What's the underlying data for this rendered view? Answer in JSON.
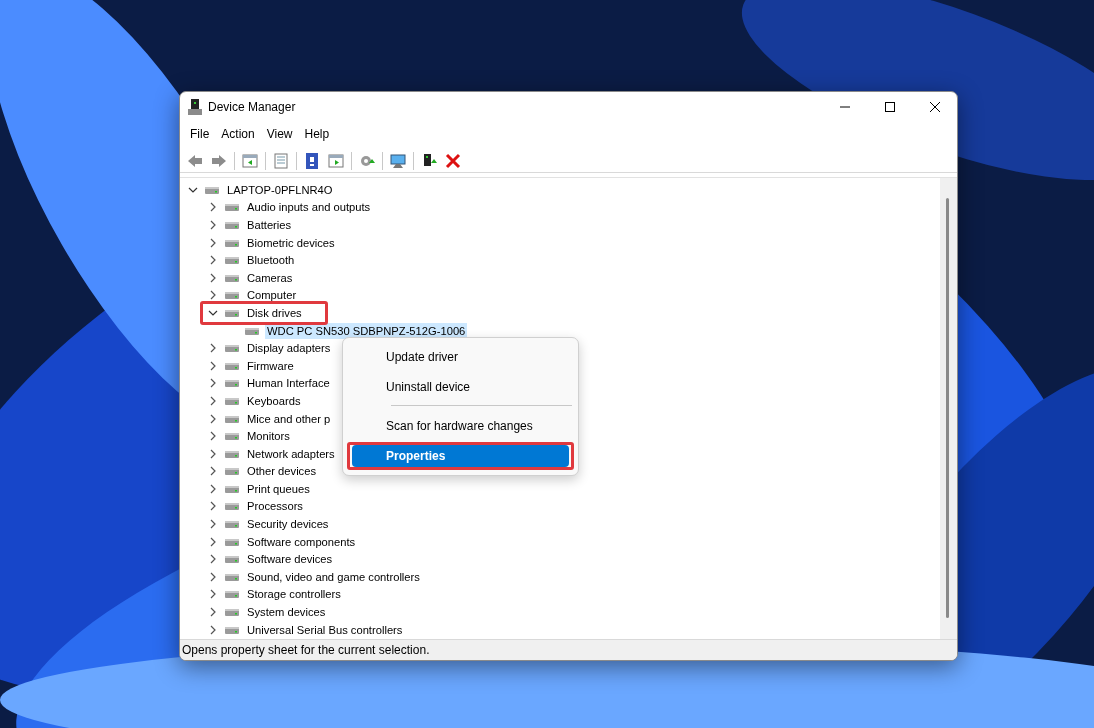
{
  "window": {
    "title": "Device Manager"
  },
  "menu": [
    "File",
    "Action",
    "View",
    "Help"
  ],
  "tree": {
    "label": "LAPTOP-0PFLNR4O",
    "expanded": true,
    "selected": false,
    "children": [
      {
        "label": "Audio inputs and outputs",
        "expanded": false,
        "selected": false
      },
      {
        "label": "Batteries",
        "expanded": false,
        "selected": false
      },
      {
        "label": "Biometric devices",
        "expanded": false,
        "selected": false
      },
      {
        "label": "Bluetooth",
        "expanded": false,
        "selected": false
      },
      {
        "label": "Cameras",
        "expanded": false,
        "selected": false
      },
      {
        "label": "Computer",
        "expanded": false,
        "selected": false
      },
      {
        "label": "Disk drives",
        "expanded": true,
        "selected": false,
        "annotated": true,
        "children": [
          {
            "label": "WDC PC SN530 SDBPNPZ-512G-1006",
            "selected": true
          }
        ]
      },
      {
        "label": "Display adapters",
        "expanded": false,
        "selected": false
      },
      {
        "label": "Firmware",
        "expanded": false,
        "selected": false
      },
      {
        "label": "Human Interface",
        "expanded": false,
        "selected": false
      },
      {
        "label": "Keyboards",
        "expanded": false,
        "selected": false
      },
      {
        "label": "Mice and other p",
        "expanded": false,
        "selected": false
      },
      {
        "label": "Monitors",
        "expanded": false,
        "selected": false
      },
      {
        "label": "Network adapters",
        "expanded": false,
        "selected": false
      },
      {
        "label": "Other devices",
        "expanded": false,
        "selected": false
      },
      {
        "label": "Print queues",
        "expanded": false,
        "selected": false
      },
      {
        "label": "Processors",
        "expanded": false,
        "selected": false
      },
      {
        "label": "Security devices",
        "expanded": false,
        "selected": false
      },
      {
        "label": "Software components",
        "expanded": false,
        "selected": false
      },
      {
        "label": "Software devices",
        "expanded": false,
        "selected": false
      },
      {
        "label": "Sound, video and game controllers",
        "expanded": false,
        "selected": false
      },
      {
        "label": "Storage controllers",
        "expanded": false,
        "selected": false
      },
      {
        "label": "System devices",
        "expanded": false,
        "selected": false
      },
      {
        "label": "Universal Serial Bus controllers",
        "expanded": false,
        "selected": false
      }
    ]
  },
  "context_menu": [
    {
      "kind": "item",
      "label": "Update driver",
      "selected": false,
      "annotated": false
    },
    {
      "kind": "item",
      "label": "Uninstall device",
      "selected": false,
      "annotated": false
    },
    {
      "kind": "separator"
    },
    {
      "kind": "item",
      "label": "Scan for hardware changes",
      "selected": false,
      "annotated": false
    },
    {
      "kind": "item",
      "label": "Properties",
      "selected": true,
      "annotated": true
    }
  ],
  "status_bar": "Opens property sheet for the current selection."
}
